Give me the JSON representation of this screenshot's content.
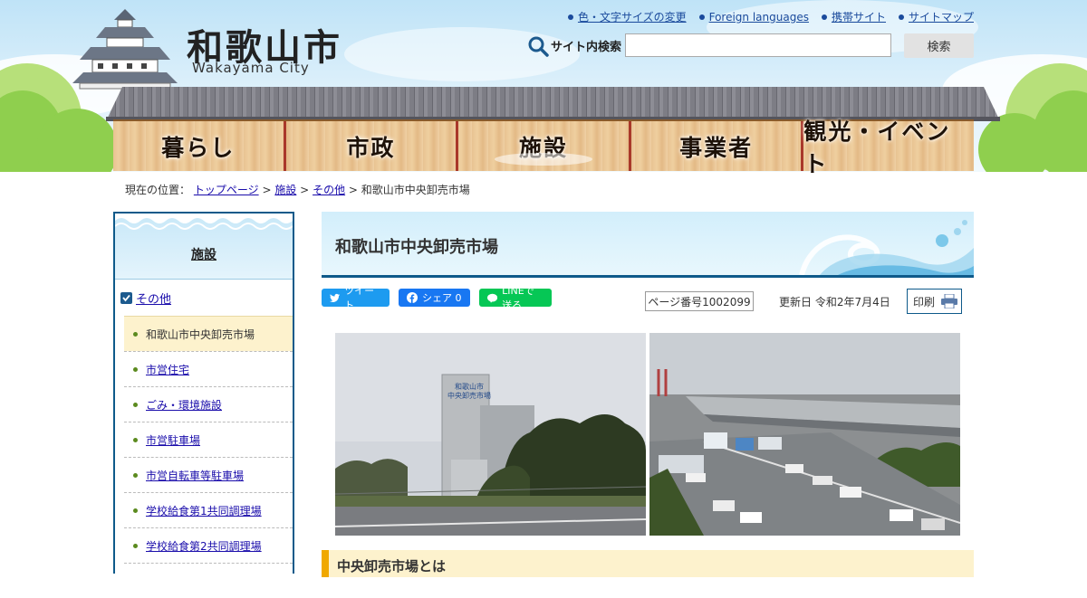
{
  "site": {
    "title": "和歌山市",
    "subtitle": "Wakayama City"
  },
  "util_links": [
    {
      "label": "色・文字サイズの変更"
    },
    {
      "label": "Foreign languages"
    },
    {
      "label": "携帯サイト"
    },
    {
      "label": "サイトマップ"
    }
  ],
  "search": {
    "label": "サイト内検索",
    "input_value": "",
    "button_label": "検索"
  },
  "nav": {
    "items": [
      {
        "label": "暮らし"
      },
      {
        "label": "市政"
      },
      {
        "label": "施設",
        "active": true
      },
      {
        "label": "事業者"
      },
      {
        "label": "観光・イベント"
      }
    ]
  },
  "breadcrumb": {
    "prefix": "現在の位置：",
    "links": [
      "トップページ",
      "施設",
      "その他"
    ],
    "separator": ">",
    "current": "和歌山市中央卸売市場"
  },
  "sidebar": {
    "title": "施設",
    "category": "その他",
    "items": [
      {
        "label": "和歌山市中央卸売市場",
        "current": true
      },
      {
        "label": "市営住宅"
      },
      {
        "label": "ごみ・環境施設"
      },
      {
        "label": "市営駐車場"
      },
      {
        "label": "市営自転車等駐車場"
      },
      {
        "label": "学校給食第1共同調理場"
      },
      {
        "label": "学校給食第2共同調理場"
      }
    ]
  },
  "main": {
    "page_title": "和歌山市中央卸売市場",
    "share": {
      "tweet": "ツイート",
      "facebook": "シェア 0",
      "line": "LINEで送る"
    },
    "page_number": "ページ番号1002099",
    "updated": "更新日 令和2年7月4日",
    "print_label": "印刷",
    "photo_sign": [
      "和歌山市",
      "中央卸売市場"
    ],
    "section_heading": "中央卸売市場とは"
  },
  "colors": {
    "accent_blue": "#0e5a8a",
    "nav_divider": "#a9382a",
    "current_item_bg": "#fdf2cd",
    "section_bar": "#f0a800"
  }
}
